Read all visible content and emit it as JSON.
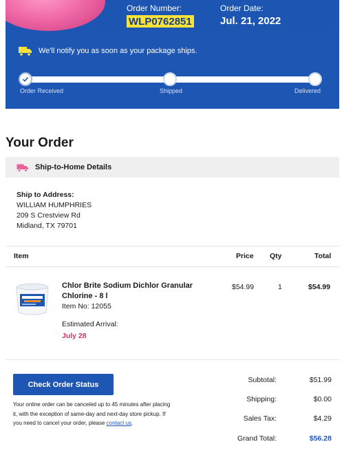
{
  "header": {
    "order_number_label": "Order Number:",
    "order_number": "WLP0762851",
    "order_date_label": "Order Date:",
    "order_date": "Jul. 21, 2022",
    "notify_text": "We'll notify you as soon as your package ships.",
    "steps": [
      "Order Received",
      "Shipped",
      "Delivered"
    ],
    "current_step": "Order Received"
  },
  "order": {
    "title": "Your Order",
    "ship_to_home_label": "Ship-to-Home Details",
    "ship_to_label": "Ship to Address:",
    "address": [
      "WILLIAM HUMPHRIES",
      "209 S Crestview Rd",
      "Midland, TX 79701"
    ],
    "columns": {
      "item": "Item",
      "price": "Price",
      "qty": "Qty",
      "total": "Total"
    },
    "item": {
      "name": "Chlor Brite Sodium Dichlor Granular Chlorine - 8 l",
      "item_no": "Item No:  12055",
      "estimated_label": "Estimated Arrival:",
      "estimated_date": "July 28",
      "price": "$54.99",
      "qty": "1",
      "total": "$54.99"
    }
  },
  "footer": {
    "check_status_button": "Check Order Status",
    "cancel_note_text": "Your online order can be canceled up to 45 minutes after placing it, with the exception of same-day and next-day store pickup. If you need to cancel your order, please ",
    "cancel_link": "contact us",
    "cancel_note_end": ".",
    "summary": [
      {
        "label": "Subtotal:",
        "value": "$51.99"
      },
      {
        "label": "Shipping:",
        "value": "$0.00"
      },
      {
        "label": "Sales Tax:",
        "value": "$4.29"
      },
      {
        "label": "Grand Total:",
        "value": "$56.28"
      }
    ]
  },
  "colors": {
    "brand_blue": "#1e56b3",
    "highlight": "#f7e23a",
    "arrival_pink": "#cc3366"
  },
  "icons": [
    "truck-icon",
    "check-icon",
    "ship-to-home-icon"
  ]
}
